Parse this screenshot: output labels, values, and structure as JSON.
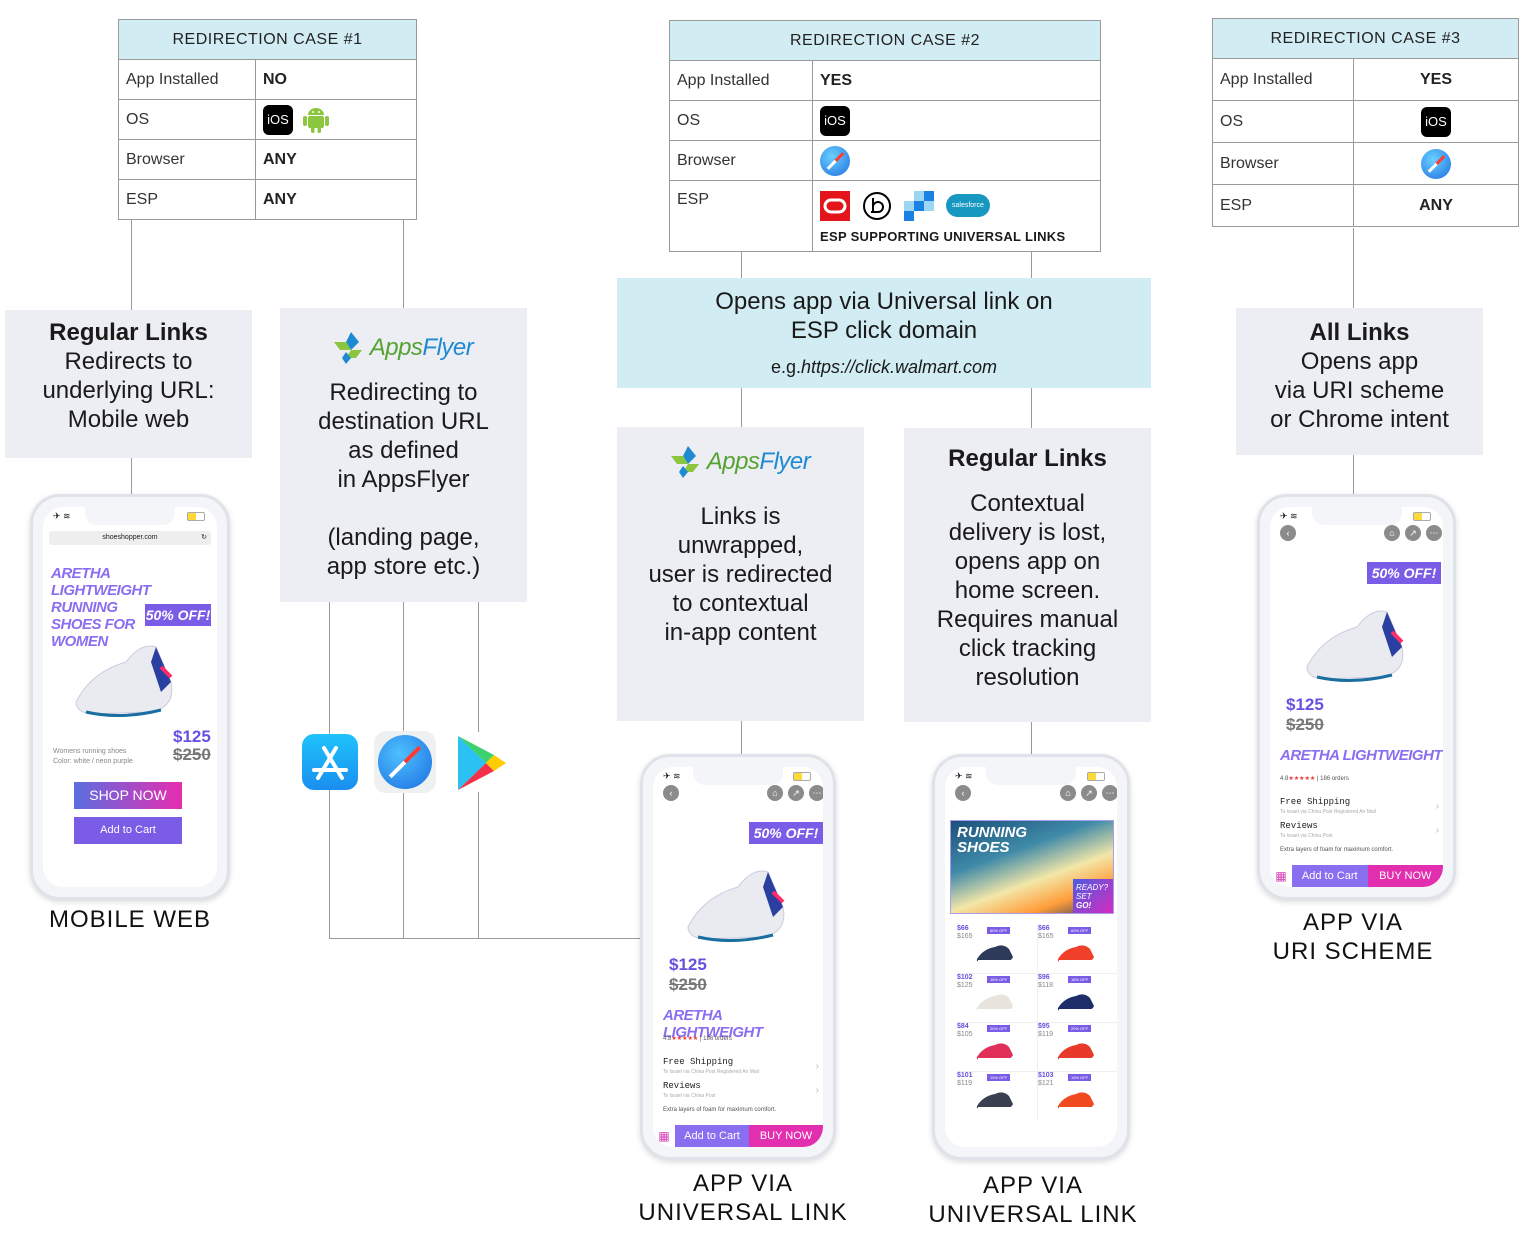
{
  "cases": [
    {
      "title": "REDIRECTION CASE #1",
      "rows": [
        {
          "label": "App Installed",
          "value": "NO"
        },
        {
          "label": "OS",
          "icons": [
            "ios-icon",
            "android-icon"
          ],
          "ios_text": "iOS"
        },
        {
          "label": "Browser",
          "value": "ANY"
        },
        {
          "label": "ESP",
          "value": "ANY"
        }
      ]
    },
    {
      "title": "REDIRECTION CASE #2",
      "rows": [
        {
          "label": "App Installed",
          "value": "YES"
        },
        {
          "label": "OS",
          "icons": [
            "ios-icon"
          ],
          "ios_text": "iOS"
        },
        {
          "label": "Browser",
          "icons": [
            "safari-icon"
          ]
        },
        {
          "label": "ESP",
          "icons": [
            "oracle-icon",
            "braze-icon",
            "sendgrid-icon",
            "salesforce-icon"
          ],
          "salesforce_text": "salesforce",
          "note": "ESP SUPPORTING UNIVERSAL LINKS"
        }
      ]
    },
    {
      "title": "REDIRECTION CASE #3",
      "rows": [
        {
          "label": "App Installed",
          "value": "YES"
        },
        {
          "label": "OS",
          "icons": [
            "ios-icon"
          ],
          "ios_text": "iOS"
        },
        {
          "label": "Browser",
          "icons": [
            "safari-icon"
          ]
        },
        {
          "label": "ESP",
          "value": "ANY"
        }
      ]
    }
  ],
  "boxes": {
    "regular_case1": {
      "title": "Regular Links",
      "lines": [
        "Redirects to",
        "underlying URL:",
        "Mobile web"
      ]
    },
    "appsflyer_case1": {
      "logo": "AppsFlyer",
      "logo_a": "Apps",
      "logo_b": "Flyer",
      "lines": [
        "Redirecting to",
        "destination URL",
        "as defined",
        "in AppsFlyer",
        "",
        "(landing page,",
        "app store etc.)"
      ]
    },
    "universal_case2": {
      "lines": [
        "Opens app via Universal link on",
        "ESP click domain"
      ],
      "example_prefix": "e.g.",
      "example_url": "https://click.walmart.com"
    },
    "appsflyer_case2": {
      "logo": "AppsFlyer",
      "logo_a": "Apps",
      "logo_b": "Flyer",
      "lines": [
        "Links is",
        "unwrapped,",
        "user is redirected",
        "to contextual",
        "in-app content"
      ]
    },
    "regular_case2": {
      "title": "Regular Links",
      "lines": [
        "Contextual",
        "delivery is lost,",
        "opens app on",
        "home screen.",
        "Requires manual",
        "click tracking",
        "resolution"
      ]
    },
    "all_case3": {
      "title": "All Links",
      "lines": [
        "Opens app",
        "via URI scheme",
        "or Chrome intent"
      ]
    }
  },
  "store_icons": [
    "app-store-icon",
    "safari-icon",
    "google-play-icon"
  ],
  "phones": {
    "mobile_web": {
      "url": "shoeshopper.com",
      "headline": [
        "ARETHA",
        "LIGHTWEIGHT",
        "RUNNING",
        "SHOES FOR",
        "WOMEN"
      ],
      "badge": "50% OFF!",
      "price_new": "$125",
      "price_old": "$250",
      "desc": [
        "Womens running shoes",
        "Color: white / neon purple"
      ],
      "shop_now": "SHOP NOW",
      "add_to_cart": "Add to Cart",
      "caption": [
        "MOBILE WEB"
      ]
    },
    "app_product": {
      "badge": "50% OFF!",
      "price_new": "$125",
      "price_old": "$250",
      "title": "ARETHA  LIGHTWEIGHT",
      "rating": "4.8",
      "stars": "★★★★★",
      "orders": "186 orders",
      "free_shipping": "Free Shipping",
      "free_shipping_sub": "To Israel via China Post Registered Air Mail",
      "reviews": "Reviews",
      "reviews_sub": "To Israel via China Post",
      "note": "Extra layers of foam for maximum comfort.",
      "add_to_cart": "Add to Cart",
      "buy_now": "BUY NOW"
    },
    "app_home": {
      "banner_title": [
        "RUNNING",
        "SHOES"
      ],
      "banner_tag": [
        "READY?",
        "SET",
        "GO!"
      ],
      "grid": [
        {
          "new": "$66",
          "old": "$165",
          "badge": "60% OFF"
        },
        {
          "new": "$66",
          "old": "$165",
          "badge": "60% OFF"
        },
        {
          "new": "$102",
          "old": "$125",
          "badge": "18% OFF"
        },
        {
          "new": "$96",
          "old": "$118",
          "badge": "18% OFF"
        },
        {
          "new": "$84",
          "old": "$105",
          "badge": "20% OFF"
        },
        {
          "new": "$95",
          "old": "$119",
          "badge": "20% OFF"
        },
        {
          "new": "$101",
          "old": "$119",
          "badge": "15% OFF"
        },
        {
          "new": "$103",
          "old": "$121",
          "badge": "15% OFF"
        }
      ]
    }
  },
  "captions": {
    "mobile_web": [
      "MOBILE WEB"
    ],
    "universal_1": [
      "APP VIA",
      "UNIVERSAL LINK"
    ],
    "universal_2": [
      "APP VIA",
      "UNIVERSAL LINK"
    ],
    "uri_scheme": [
      "APP VIA",
      "URI SCHEME"
    ]
  }
}
